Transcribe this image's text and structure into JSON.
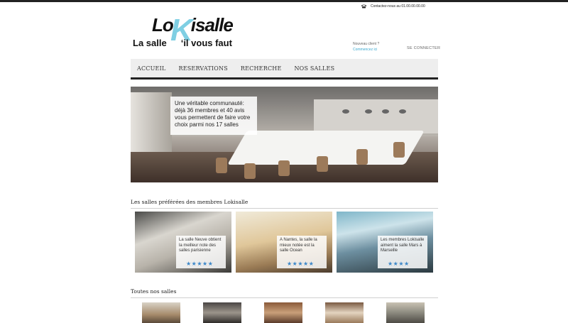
{
  "header": {
    "contact_text": "Contactez-nous au 01.00.00.00.00",
    "logo": {
      "text_top": "Lo",
      "letter_k": "K",
      "text_top_rest": "isalle",
      "text_bottom_left": "La salle",
      "text_bottom_right": "‘il vous faut"
    },
    "account": {
      "new_client": "Nouveau client ?",
      "start_link": "Commencez ici",
      "login_link": "SE CONNECTER"
    }
  },
  "nav": {
    "items": [
      "ACCUEIL",
      "RESERVATIONS",
      "RECHERCHE",
      "NOS SALLES"
    ]
  },
  "hero": {
    "caption": "Une véritable communauté: déjà 36 membres et 40 avis vous permettent de faire votre choix parmi nos 17 salles"
  },
  "favorites": {
    "title": "Les salles préférées des membres Lokisalle",
    "cards": [
      {
        "text": "La salle Neuve obtient la meilleur note des salles parisienne",
        "stars": "★★★★★"
      },
      {
        "text": "A Nantes, la salle la mieux notée est la salle Ocean",
        "stars": "★★★★★"
      },
      {
        "text": "Les membres Lokisalle aiment la salle Mars à Marseille",
        "stars": "★★★★"
      }
    ]
  },
  "all_rooms": {
    "title": "Toutes nos salles"
  },
  "colors": {
    "accent": "#3aa8cf",
    "logo_k": "#7fcfe3",
    "nav_bg": "#eeeeee",
    "star": "#3a86c8"
  }
}
